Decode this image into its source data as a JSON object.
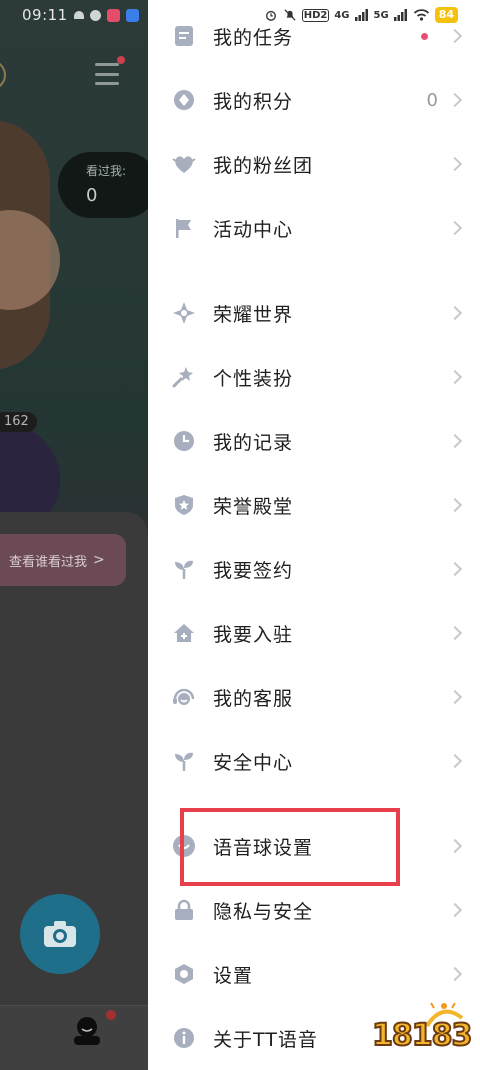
{
  "status_bar": {
    "time": "09:11",
    "network_labels": [
      "HD2",
      "4G",
      "5G"
    ],
    "battery": "84"
  },
  "background": {
    "visited_label": "看过我:",
    "visited_count": "0",
    "number_pill": "162",
    "who_visited_button": "查看谁看过我",
    "who_visited_chevron": ">"
  },
  "drawer": {
    "items": [
      {
        "label": "我的任务",
        "icon": "task-icon"
      },
      {
        "label": "我的积分",
        "icon": "points-icon",
        "value": "0"
      },
      {
        "label": "我的粉丝团",
        "icon": "fan-heart-icon"
      },
      {
        "label": "活动中心",
        "icon": "flag-icon"
      },
      {
        "label": "荣耀世界",
        "icon": "glory-star-icon"
      },
      {
        "label": "个性装扮",
        "icon": "magic-wand-icon"
      },
      {
        "label": "我的记录",
        "icon": "clock-icon"
      },
      {
        "label": "荣誉殿堂",
        "icon": "shield-star-icon"
      },
      {
        "label": "我要签约",
        "icon": "sprout-icon"
      },
      {
        "label": "我要入驻",
        "icon": "house-icon"
      },
      {
        "label": "我的客服",
        "icon": "headset-icon"
      },
      {
        "label": "安全中心",
        "icon": "sprout-icon"
      },
      {
        "label": "语音球设置",
        "icon": "voice-ball-icon"
      },
      {
        "label": "隐私与安全",
        "icon": "lock-icon"
      },
      {
        "label": "设置",
        "icon": "gear-icon"
      },
      {
        "label": "关于TT语音",
        "icon": "info-icon"
      }
    ]
  },
  "watermark": {
    "text": "18183"
  },
  "colors": {
    "icon_gray": "#a7aebd",
    "highlight": "#e8404a",
    "battery": "#f4c20d",
    "badge": "#ea4f72"
  }
}
